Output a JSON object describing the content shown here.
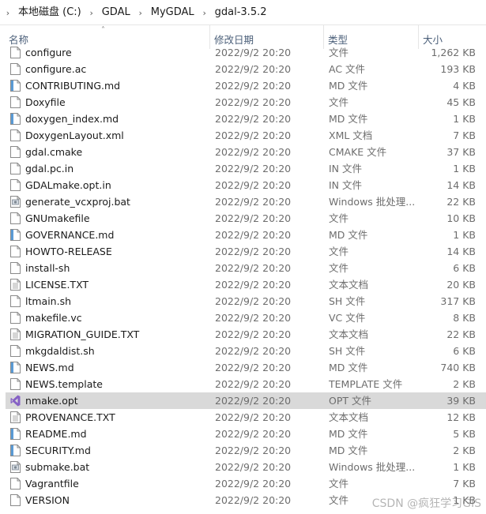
{
  "breadcrumb": {
    "items": [
      "本地磁盘 (C:)",
      "GDAL",
      "MyGDAL",
      "gdal-3.5.2"
    ]
  },
  "columns": {
    "name": "名称",
    "date": "修改日期",
    "type": "类型",
    "size": "大小"
  },
  "files": [
    {
      "name": "configure",
      "date": "2022/9/2 20:20",
      "type": "文件",
      "size": "1,262 KB",
      "icon": "generic-file-icon"
    },
    {
      "name": "configure.ac",
      "date": "2022/9/2 20:20",
      "type": "AC 文件",
      "size": "193 KB",
      "icon": "generic-file-icon"
    },
    {
      "name": "CONTRIBUTING.md",
      "date": "2022/9/2 20:20",
      "type": "MD 文件",
      "size": "4 KB",
      "icon": "markdown-file-icon"
    },
    {
      "name": "Doxyfile",
      "date": "2022/9/2 20:20",
      "type": "文件",
      "size": "45 KB",
      "icon": "generic-file-icon"
    },
    {
      "name": "doxygen_index.md",
      "date": "2022/9/2 20:20",
      "type": "MD 文件",
      "size": "1 KB",
      "icon": "markdown-file-icon"
    },
    {
      "name": "DoxygenLayout.xml",
      "date": "2022/9/2 20:20",
      "type": "XML 文档",
      "size": "7 KB",
      "icon": "generic-file-icon"
    },
    {
      "name": "gdal.cmake",
      "date": "2022/9/2 20:20",
      "type": "CMAKE 文件",
      "size": "37 KB",
      "icon": "generic-file-icon"
    },
    {
      "name": "gdal.pc.in",
      "date": "2022/9/2 20:20",
      "type": "IN 文件",
      "size": "1 KB",
      "icon": "generic-file-icon"
    },
    {
      "name": "GDALmake.opt.in",
      "date": "2022/9/2 20:20",
      "type": "IN 文件",
      "size": "14 KB",
      "icon": "generic-file-icon"
    },
    {
      "name": "generate_vcxproj.bat",
      "date": "2022/9/2 20:20",
      "type": "Windows 批处理...",
      "size": "22 KB",
      "icon": "batch-file-icon"
    },
    {
      "name": "GNUmakefile",
      "date": "2022/9/2 20:20",
      "type": "文件",
      "size": "10 KB",
      "icon": "generic-file-icon"
    },
    {
      "name": "GOVERNANCE.md",
      "date": "2022/9/2 20:20",
      "type": "MD 文件",
      "size": "1 KB",
      "icon": "markdown-file-icon"
    },
    {
      "name": "HOWTO-RELEASE",
      "date": "2022/9/2 20:20",
      "type": "文件",
      "size": "14 KB",
      "icon": "generic-file-icon"
    },
    {
      "name": "install-sh",
      "date": "2022/9/2 20:20",
      "type": "文件",
      "size": "6 KB",
      "icon": "generic-file-icon"
    },
    {
      "name": "LICENSE.TXT",
      "date": "2022/9/2 20:20",
      "type": "文本文档",
      "size": "20 KB",
      "icon": "text-file-icon"
    },
    {
      "name": "ltmain.sh",
      "date": "2022/9/2 20:20",
      "type": "SH 文件",
      "size": "317 KB",
      "icon": "generic-file-icon"
    },
    {
      "name": "makefile.vc",
      "date": "2022/9/2 20:20",
      "type": "VC 文件",
      "size": "8 KB",
      "icon": "generic-file-icon"
    },
    {
      "name": "MIGRATION_GUIDE.TXT",
      "date": "2022/9/2 20:20",
      "type": "文本文档",
      "size": "22 KB",
      "icon": "text-file-icon"
    },
    {
      "name": "mkgdaldist.sh",
      "date": "2022/9/2 20:20",
      "type": "SH 文件",
      "size": "6 KB",
      "icon": "generic-file-icon"
    },
    {
      "name": "NEWS.md",
      "date": "2022/9/2 20:20",
      "type": "MD 文件",
      "size": "740 KB",
      "icon": "markdown-file-icon"
    },
    {
      "name": "NEWS.template",
      "date": "2022/9/2 20:20",
      "type": "TEMPLATE 文件",
      "size": "2 KB",
      "icon": "generic-file-icon"
    },
    {
      "name": "nmake.opt",
      "date": "2022/9/2 20:20",
      "type": "OPT 文件",
      "size": "39 KB",
      "icon": "visual-studio-icon",
      "selected": true
    },
    {
      "name": "PROVENANCE.TXT",
      "date": "2022/9/2 20:20",
      "type": "文本文档",
      "size": "12 KB",
      "icon": "text-file-icon"
    },
    {
      "name": "README.md",
      "date": "2022/9/2 20:20",
      "type": "MD 文件",
      "size": "5 KB",
      "icon": "markdown-file-icon"
    },
    {
      "name": "SECURITY.md",
      "date": "2022/9/2 20:20",
      "type": "MD 文件",
      "size": "2 KB",
      "icon": "markdown-file-icon"
    },
    {
      "name": "submake.bat",
      "date": "2022/9/2 20:20",
      "type": "Windows 批处理...",
      "size": "1 KB",
      "icon": "batch-file-icon"
    },
    {
      "name": "Vagrantfile",
      "date": "2022/9/2 20:20",
      "type": "文件",
      "size": "7 KB",
      "icon": "generic-file-icon"
    },
    {
      "name": "VERSION",
      "date": "2022/9/2 20:20",
      "type": "文件",
      "size": "1 KB",
      "icon": "generic-file-icon"
    }
  ],
  "watermark": "CSDN @疯狂学习GIS",
  "colors": {
    "selected_row": "#d9d9d9",
    "header_text": "#4c607a",
    "secondary_text": "#6d6d6d",
    "vs_purple": "#8661c5",
    "md_blue": "#5a9bd6"
  }
}
